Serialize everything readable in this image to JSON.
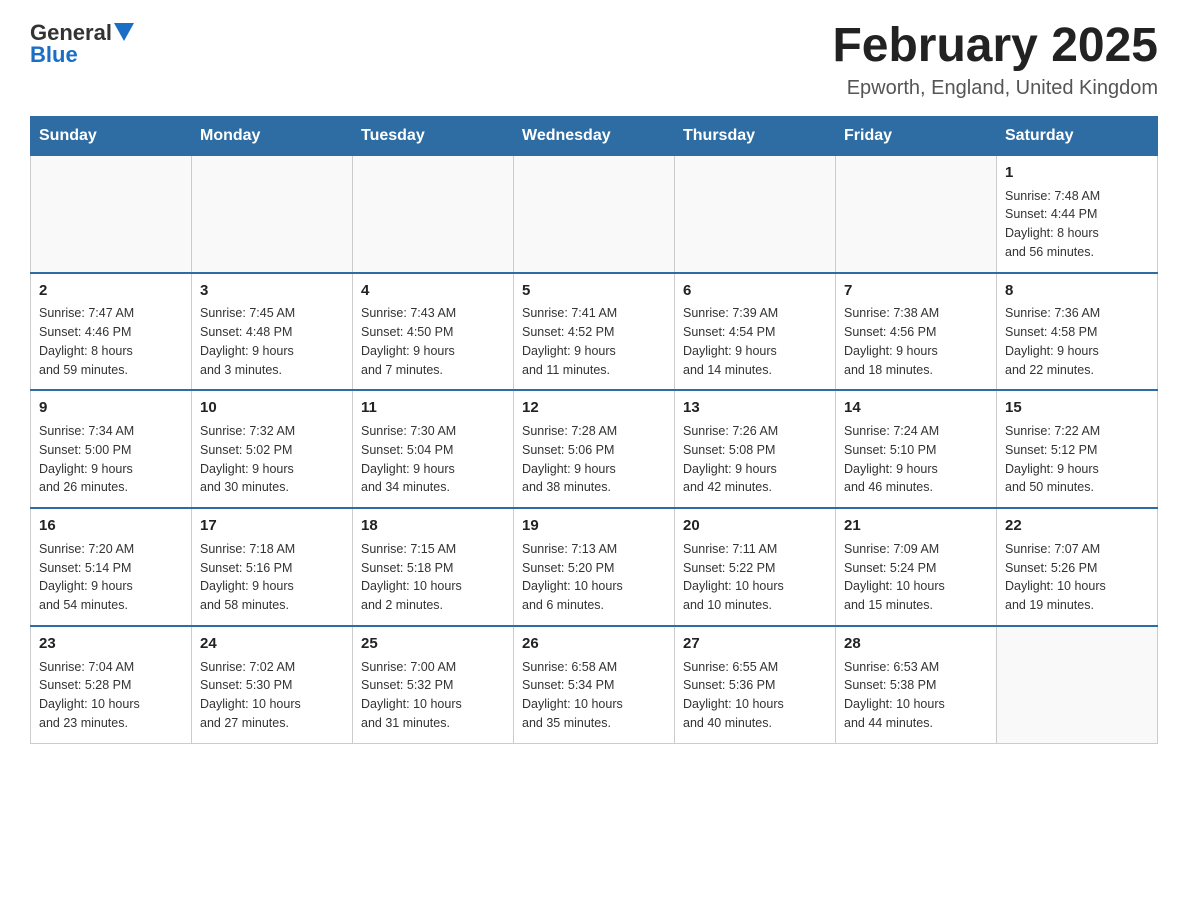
{
  "header": {
    "logo": {
      "general": "General",
      "blue": "Blue"
    },
    "title": "February 2025",
    "location": "Epworth, England, United Kingdom"
  },
  "days_of_week": [
    "Sunday",
    "Monday",
    "Tuesday",
    "Wednesday",
    "Thursday",
    "Friday",
    "Saturday"
  ],
  "weeks": [
    {
      "days": [
        {
          "num": "",
          "info": ""
        },
        {
          "num": "",
          "info": ""
        },
        {
          "num": "",
          "info": ""
        },
        {
          "num": "",
          "info": ""
        },
        {
          "num": "",
          "info": ""
        },
        {
          "num": "",
          "info": ""
        },
        {
          "num": "1",
          "info": "Sunrise: 7:48 AM\nSunset: 4:44 PM\nDaylight: 8 hours\nand 56 minutes."
        }
      ]
    },
    {
      "days": [
        {
          "num": "2",
          "info": "Sunrise: 7:47 AM\nSunset: 4:46 PM\nDaylight: 8 hours\nand 59 minutes."
        },
        {
          "num": "3",
          "info": "Sunrise: 7:45 AM\nSunset: 4:48 PM\nDaylight: 9 hours\nand 3 minutes."
        },
        {
          "num": "4",
          "info": "Sunrise: 7:43 AM\nSunset: 4:50 PM\nDaylight: 9 hours\nand 7 minutes."
        },
        {
          "num": "5",
          "info": "Sunrise: 7:41 AM\nSunset: 4:52 PM\nDaylight: 9 hours\nand 11 minutes."
        },
        {
          "num": "6",
          "info": "Sunrise: 7:39 AM\nSunset: 4:54 PM\nDaylight: 9 hours\nand 14 minutes."
        },
        {
          "num": "7",
          "info": "Sunrise: 7:38 AM\nSunset: 4:56 PM\nDaylight: 9 hours\nand 18 minutes."
        },
        {
          "num": "8",
          "info": "Sunrise: 7:36 AM\nSunset: 4:58 PM\nDaylight: 9 hours\nand 22 minutes."
        }
      ]
    },
    {
      "days": [
        {
          "num": "9",
          "info": "Sunrise: 7:34 AM\nSunset: 5:00 PM\nDaylight: 9 hours\nand 26 minutes."
        },
        {
          "num": "10",
          "info": "Sunrise: 7:32 AM\nSunset: 5:02 PM\nDaylight: 9 hours\nand 30 minutes."
        },
        {
          "num": "11",
          "info": "Sunrise: 7:30 AM\nSunset: 5:04 PM\nDaylight: 9 hours\nand 34 minutes."
        },
        {
          "num": "12",
          "info": "Sunrise: 7:28 AM\nSunset: 5:06 PM\nDaylight: 9 hours\nand 38 minutes."
        },
        {
          "num": "13",
          "info": "Sunrise: 7:26 AM\nSunset: 5:08 PM\nDaylight: 9 hours\nand 42 minutes."
        },
        {
          "num": "14",
          "info": "Sunrise: 7:24 AM\nSunset: 5:10 PM\nDaylight: 9 hours\nand 46 minutes."
        },
        {
          "num": "15",
          "info": "Sunrise: 7:22 AM\nSunset: 5:12 PM\nDaylight: 9 hours\nand 50 minutes."
        }
      ]
    },
    {
      "days": [
        {
          "num": "16",
          "info": "Sunrise: 7:20 AM\nSunset: 5:14 PM\nDaylight: 9 hours\nand 54 minutes."
        },
        {
          "num": "17",
          "info": "Sunrise: 7:18 AM\nSunset: 5:16 PM\nDaylight: 9 hours\nand 58 minutes."
        },
        {
          "num": "18",
          "info": "Sunrise: 7:15 AM\nSunset: 5:18 PM\nDaylight: 10 hours\nand 2 minutes."
        },
        {
          "num": "19",
          "info": "Sunrise: 7:13 AM\nSunset: 5:20 PM\nDaylight: 10 hours\nand 6 minutes."
        },
        {
          "num": "20",
          "info": "Sunrise: 7:11 AM\nSunset: 5:22 PM\nDaylight: 10 hours\nand 10 minutes."
        },
        {
          "num": "21",
          "info": "Sunrise: 7:09 AM\nSunset: 5:24 PM\nDaylight: 10 hours\nand 15 minutes."
        },
        {
          "num": "22",
          "info": "Sunrise: 7:07 AM\nSunset: 5:26 PM\nDaylight: 10 hours\nand 19 minutes."
        }
      ]
    },
    {
      "days": [
        {
          "num": "23",
          "info": "Sunrise: 7:04 AM\nSunset: 5:28 PM\nDaylight: 10 hours\nand 23 minutes."
        },
        {
          "num": "24",
          "info": "Sunrise: 7:02 AM\nSunset: 5:30 PM\nDaylight: 10 hours\nand 27 minutes."
        },
        {
          "num": "25",
          "info": "Sunrise: 7:00 AM\nSunset: 5:32 PM\nDaylight: 10 hours\nand 31 minutes."
        },
        {
          "num": "26",
          "info": "Sunrise: 6:58 AM\nSunset: 5:34 PM\nDaylight: 10 hours\nand 35 minutes."
        },
        {
          "num": "27",
          "info": "Sunrise: 6:55 AM\nSunset: 5:36 PM\nDaylight: 10 hours\nand 40 minutes."
        },
        {
          "num": "28",
          "info": "Sunrise: 6:53 AM\nSunset: 5:38 PM\nDaylight: 10 hours\nand 44 minutes."
        },
        {
          "num": "",
          "info": ""
        }
      ]
    }
  ]
}
